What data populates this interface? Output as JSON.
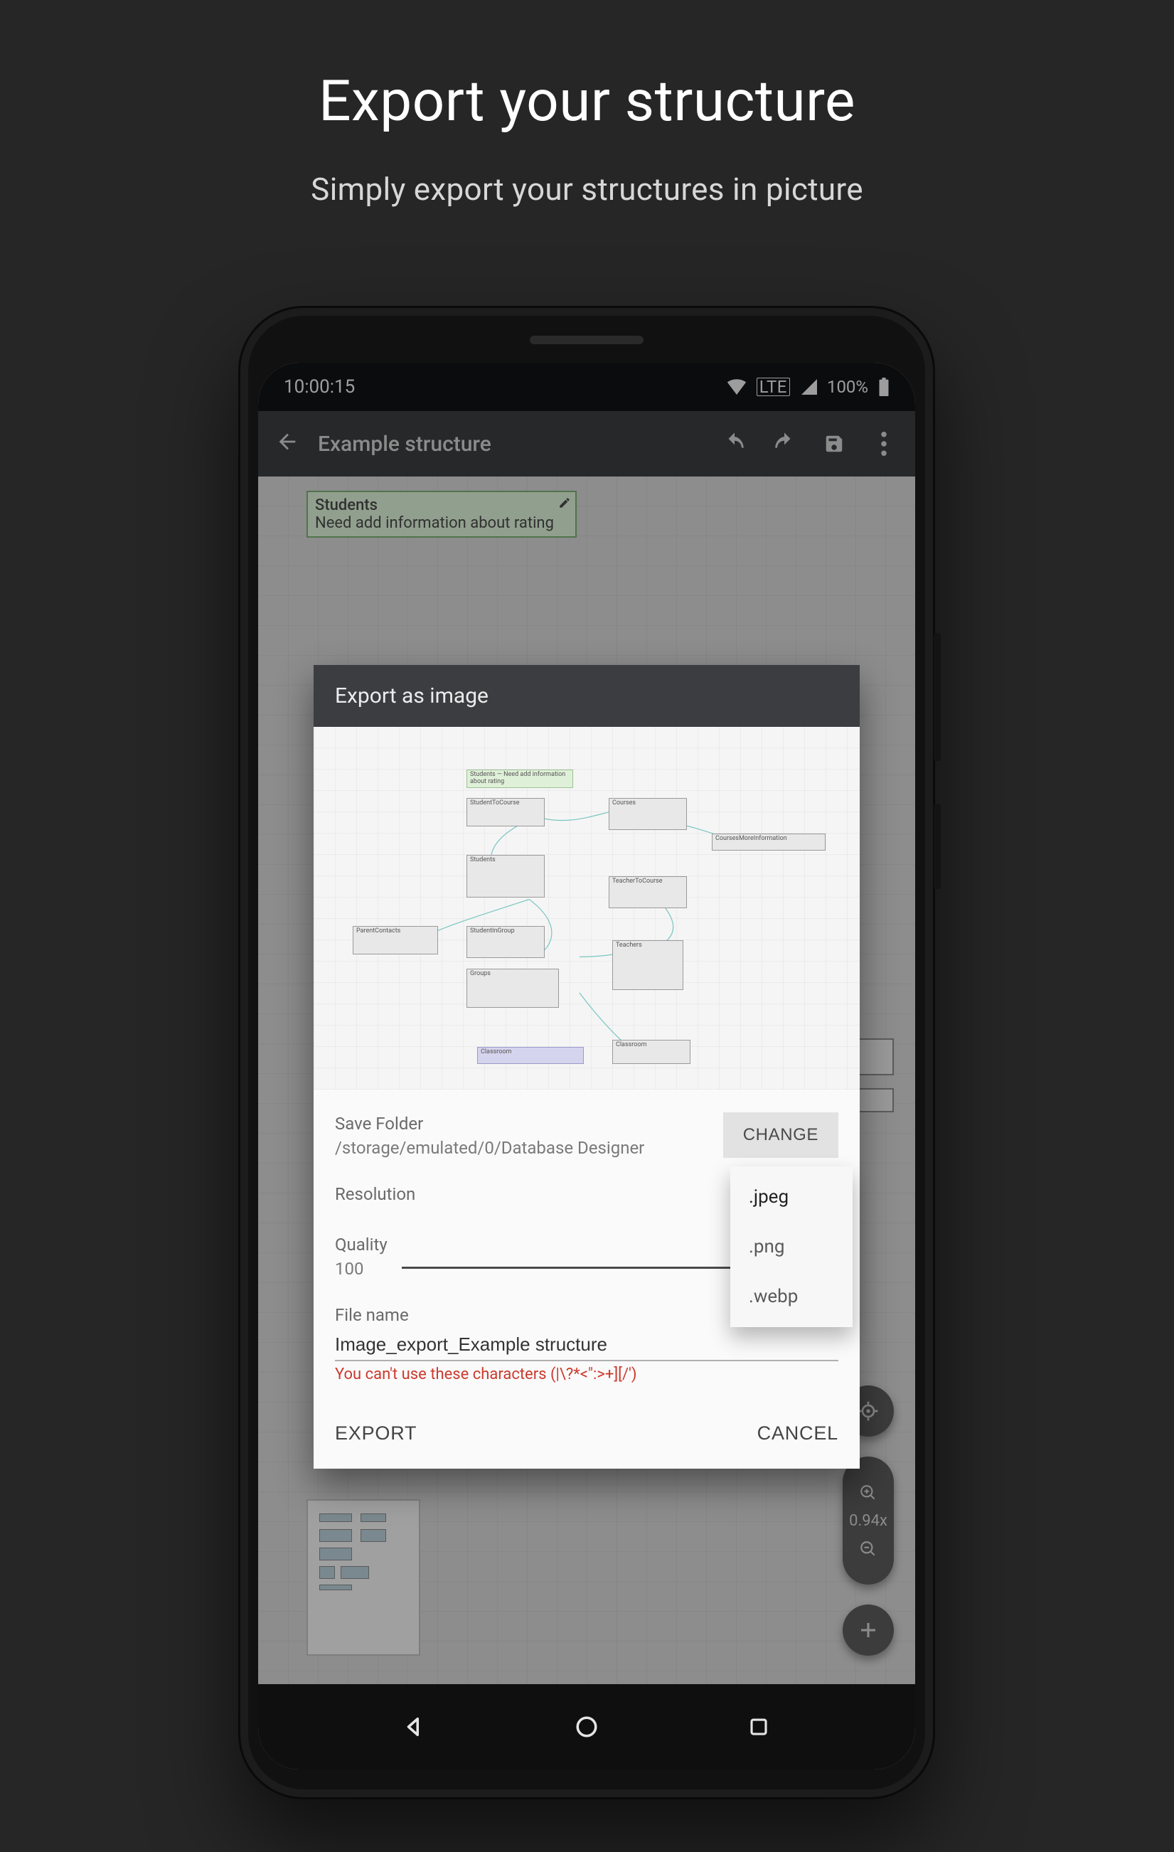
{
  "marketing": {
    "title": "Export your structure",
    "subtitle": "Simply export your structures in picture"
  },
  "statusbar": {
    "time": "10:00:15",
    "battery_pct": "100%"
  },
  "appbar": {
    "title": "Example structure",
    "icons": {
      "back": "back-icon",
      "undo": "undo-icon",
      "redo": "redo-icon",
      "save": "save-icon",
      "overflow": "overflow-icon"
    }
  },
  "bg_sticky": {
    "title": "Students",
    "body": "Need add information about rating"
  },
  "floating": {
    "zoom_level": "0.94x"
  },
  "modal": {
    "title": "Export as image",
    "save_folder": {
      "label": "Save Folder",
      "path": "/storage/emulated/0/Database Designer",
      "change": "CHANGE"
    },
    "resolution": {
      "label": "Resolution",
      "selected": ".jpeg",
      "options": [
        ".jpeg",
        ".png",
        ".webp"
      ]
    },
    "quality": {
      "label": "Quality",
      "value": "100"
    },
    "filename": {
      "label": "File name",
      "value": "Image_export_Example structure",
      "error": "You can't use these characters (|\\?*<\":>+][/')"
    },
    "actions": {
      "export": "EXPORT",
      "cancel": "CANCEL"
    }
  },
  "preview_nodes": {
    "studentsNote": "Students — Need add information about rating",
    "studentToCourse": "StudentToCourse",
    "students": "Students",
    "parentContacts": "ParentContacts",
    "studentInGroup": "StudentInGroup",
    "groups": "Groups",
    "classroom": "Classroom",
    "courses": "Courses",
    "coursesMore": "CoursesMoreInformation",
    "teacherToCourse": "TeacherToCourse",
    "teachers": "Teachers",
    "classroom2": "Classroom"
  }
}
